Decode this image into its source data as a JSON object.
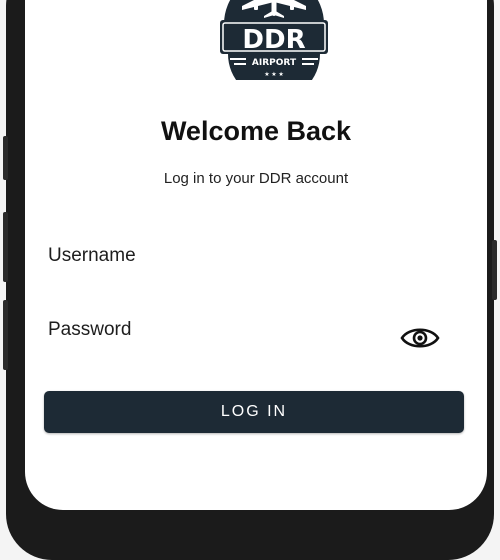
{
  "app": {
    "logo_text": "DDR",
    "logo_subtext": "AIRPORT"
  },
  "login": {
    "title": "Welcome Back",
    "subtitle": "Log in to your DDR account",
    "username_label": "Username",
    "username_value": "",
    "password_label": "Password",
    "password_value": "",
    "login_button": "LOG IN"
  },
  "icons": {
    "logo": "airplane-logo",
    "show_password": "eye-icon"
  },
  "colors": {
    "brand_dark": "#1d2a35",
    "background": "#ffffff",
    "text": "#111111"
  }
}
